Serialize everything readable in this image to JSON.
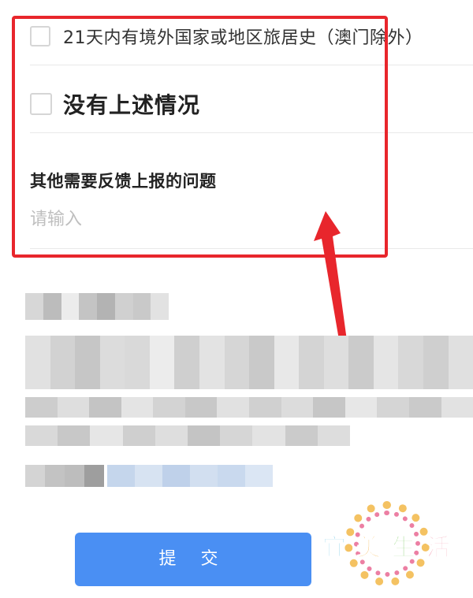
{
  "form": {
    "options": [
      {
        "label": "21天内有境外国家或地区旅居史（澳门除外）",
        "checked": false
      },
      {
        "label": "没有上述情况",
        "checked": false
      }
    ],
    "feedback": {
      "title": "其他需要反馈上报的问题",
      "placeholder": "请输入",
      "value": ""
    }
  },
  "submit": {
    "label": "提 交"
  },
  "watermark": {
    "text": [
      "宜",
      "美",
      "生",
      "活"
    ],
    "colors": [
      "#22a6d8",
      "#f39c12",
      "#5bbf3a",
      "#e94c6f"
    ]
  },
  "annotation": {
    "color": "#e8262c"
  }
}
